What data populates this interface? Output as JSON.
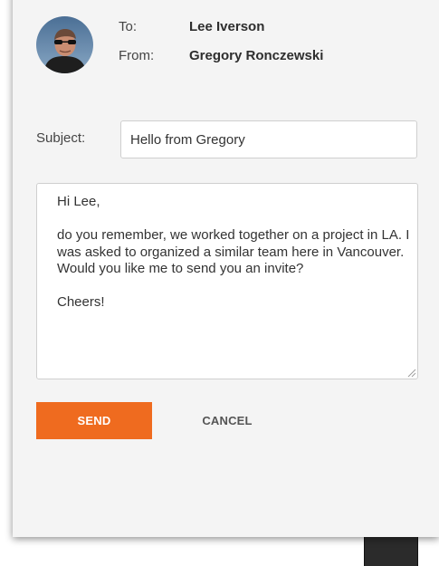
{
  "header": {
    "to_label": "To:",
    "to_value": "Lee Iverson",
    "from_label": "From:",
    "from_value": "Gregory Ronczewski",
    "avatar_icon": "user-avatar-photo"
  },
  "subject": {
    "label": "Subject:",
    "value": "Hello from Gregory"
  },
  "message": {
    "body": "Hi Lee,\n\ndo you remember, we worked together on a project in LA. I was asked to organized a similar team here in Vancouver.\nWould you like me to send you an invite?\n\nCheers!",
    "resize_icon": "resize-handle-icon"
  },
  "actions": {
    "send_label": "SEND",
    "cancel_label": "CANCEL"
  },
  "colors": {
    "send_button": "#ef6b1f",
    "dialog_background": "#f4f4f4",
    "backdrop_dark": "#2b2b2b"
  }
}
